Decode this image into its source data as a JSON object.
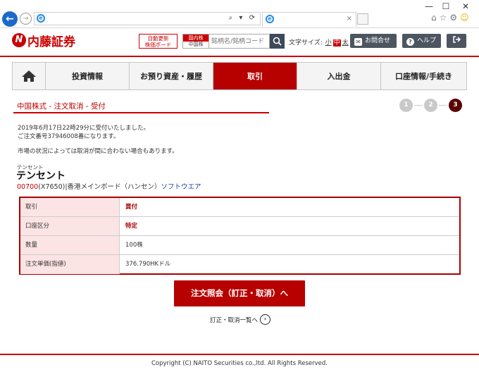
{
  "browser": {
    "window_controls": [
      "—",
      "☐",
      "✕"
    ],
    "address_tools": "⌕ ▾ ⟳",
    "tab_close": "×"
  },
  "header": {
    "logo_text": "内藤証券",
    "auto_update_label": "自動更新\n株価ボード",
    "market_domestic": "国内株",
    "market_china": "中国株",
    "search_placeholder": "銘柄名/銘柄コード",
    "font_size_label": "文字サイズ:",
    "font_small": "小",
    "font_medium": "中",
    "font_large": "太",
    "contact_label": "お問合せ",
    "help_label": "ヘルプ"
  },
  "nav": {
    "items": [
      {
        "label": "投資情報"
      },
      {
        "label": "お預り資産・履歴"
      },
      {
        "label": "取引"
      },
      {
        "label": "入出金"
      },
      {
        "label": "口座情報/手続き"
      }
    ]
  },
  "page": {
    "title": "中国株式 - 注文取消 - 受付",
    "steps": [
      "1",
      "2",
      "3"
    ],
    "message_line1": "2019年6月17日22時29分に受付いたしました。",
    "message_line2": "ご注文番号37946008番になります。",
    "message_line3": "市場の状況によっては取消が間に合わない場合もあります。"
  },
  "stock": {
    "kana": "テンセント",
    "name": "テンセント",
    "code": "00700",
    "info": "(X7650)|香港メインボード（ハンセン）",
    "sector": "ソフトウエア"
  },
  "order": {
    "rows": [
      {
        "label": "取引",
        "value": "買付"
      },
      {
        "label": "口座区分",
        "value": "特定"
      },
      {
        "label": "数量",
        "value": "100株"
      },
      {
        "label": "注文単価(指値)",
        "value": "376.790HKドル"
      }
    ]
  },
  "actions": {
    "inquiry_button": "注文照会（訂正・取消）へ",
    "list_link": "訂正・取消一覧へ"
  },
  "footer": {
    "copyright": "Copyright (C) NAITO Securities co.,ltd. All Rights Reserved."
  },
  "colors": {
    "brand_red": "#c00000",
    "nav_active": "#b70000",
    "step_current": "#5a0000",
    "step_inactive": "#c9c9c9",
    "table_key_bg": "#fde4e4"
  }
}
